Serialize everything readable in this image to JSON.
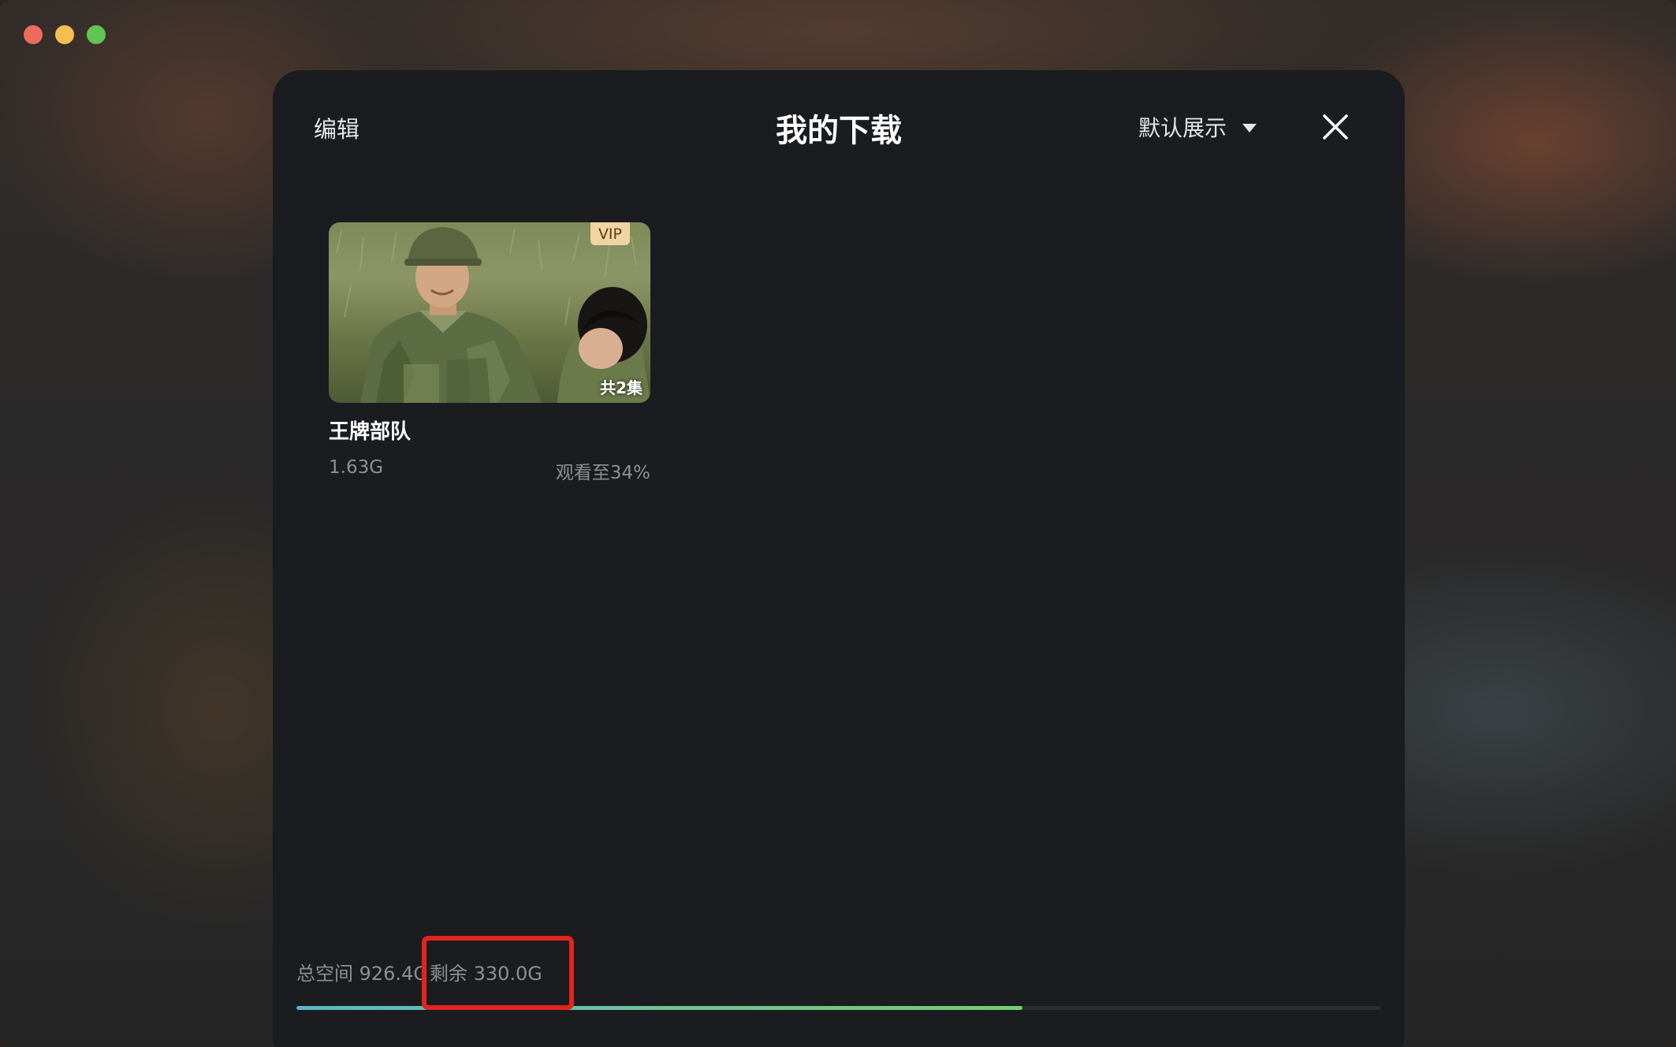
{
  "window": {
    "controls": [
      "close",
      "minimize",
      "maximize"
    ]
  },
  "header": {
    "edit_label": "编辑",
    "title": "我的下载",
    "sort_label": "默认展示",
    "close_icon": "close-icon"
  },
  "downloads": [
    {
      "title": "王牌部队",
      "badge": "VIP",
      "episodes": "共2集",
      "size": "1.63G",
      "progress": "观看至34%"
    }
  ],
  "storage": {
    "total_text": "总空间 926.4G",
    "remaining_text": "剩余 330.0G",
    "used_fraction": 0.669
  },
  "colors": {
    "modal_bg": "#1b1c1f",
    "vip_badge": "#f1d4a2",
    "bar_fill_start": "#5bb7c5",
    "bar_fill_end": "#6ed073",
    "highlight": "#e3241d"
  }
}
